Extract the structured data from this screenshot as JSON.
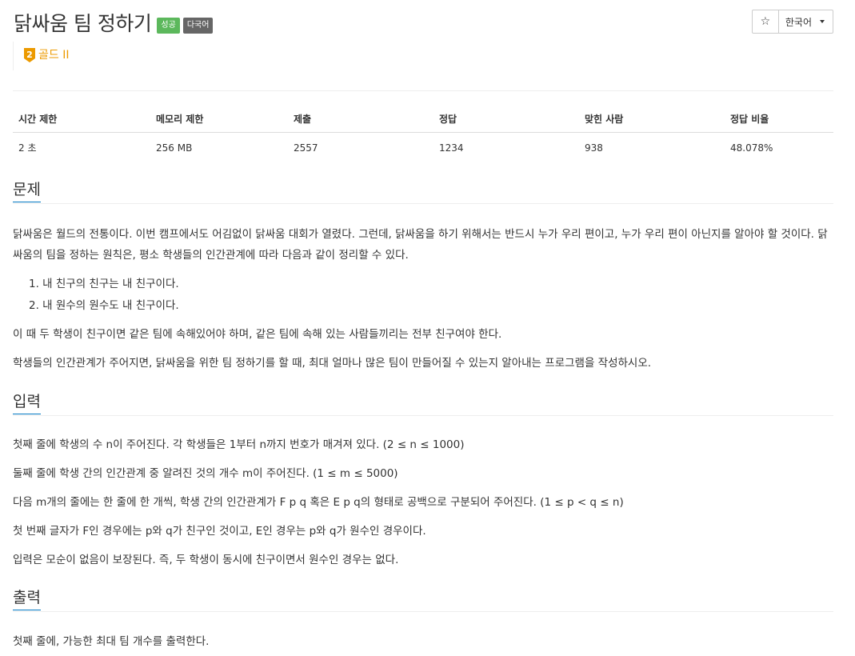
{
  "problem": {
    "title": "닭싸움 팀 정하기",
    "badges": {
      "success": "성공",
      "multilang": "다국어"
    },
    "tier": {
      "level": "2",
      "label": "골드 II",
      "color": "#ec9a00"
    }
  },
  "actions": {
    "star_icon": "☆",
    "language_select": "한국어"
  },
  "info_table": {
    "headers": [
      "시간 제한",
      "메모리 제한",
      "제출",
      "정답",
      "맞힌 사람",
      "정답 비율"
    ],
    "values": [
      "2 초",
      "256 MB",
      "2557",
      "1234",
      "938",
      "48.078%"
    ]
  },
  "sections": {
    "description": {
      "heading": "문제",
      "p1": "닭싸움은 월드의 전통이다. 이번 캠프에서도 어김없이 닭싸움 대회가 열렸다. 그런데, 닭싸움을 하기 위해서는 반드시 누가 우리 편이고, 누가 우리 편이 아닌지를 알아야 할 것이다. 닭싸움의 팀을 정하는 원칙은, 평소 학생들의 인간관계에 따라 다음과 같이 정리할 수 있다.",
      "rules": [
        "1. 내 친구의 친구는 내 친구이다.",
        "2. 내 원수의 원수도 내 친구이다."
      ],
      "p2": "이 때 두 학생이 친구이면 같은 팀에 속해있어야 하며, 같은 팀에 속해 있는 사람들끼리는 전부 친구여야 한다.",
      "p3": "학생들의 인간관계가 주어지면, 닭싸움을 위한 팀 정하기를 할 때, 최대 얼마나 많은 팀이 만들어질 수 있는지 알아내는 프로그램을 작성하시오."
    },
    "input": {
      "heading": "입력",
      "lines": [
        "첫째 줄에 학생의 수 n이 주어진다. 각 학생들은 1부터 n까지 번호가 매겨져 있다. (2 ≤ n ≤ 1000)",
        "둘째 줄에 학생 간의 인간관계 중 알려진 것의 개수 m이 주어진다. (1 ≤ m ≤ 5000)",
        "다음 m개의 줄에는 한 줄에 한 개씩, 학생 간의 인간관계가 F p q 혹은 E p q의 형태로 공백으로 구분되어 주어진다. (1 ≤ p < q ≤ n)",
        "첫 번째 글자가 F인 경우에는 p와 q가 친구인 것이고, E인 경우는 p와 q가 원수인 경우이다.",
        "입력은 모순이 없음이 보장된다. 즉, 두 학생이 동시에 친구이면서 원수인 경우는 없다."
      ]
    },
    "output": {
      "heading": "출력",
      "lines": [
        "첫째 줄에, 가능한 최대 팀 개수를 출력한다."
      ]
    }
  }
}
